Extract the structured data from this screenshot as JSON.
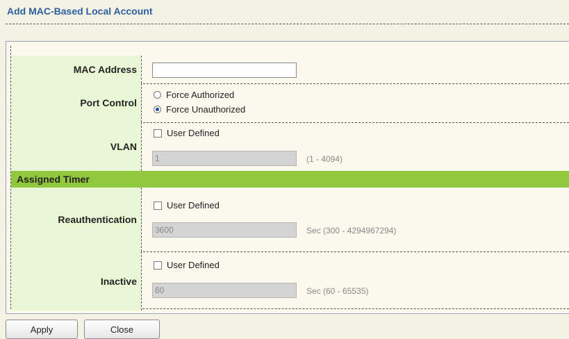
{
  "page": {
    "title": "Add MAC-Based Local Account"
  },
  "form": {
    "mac_address": {
      "label": "MAC Address",
      "value": ""
    },
    "port_control": {
      "label": "Port Control",
      "options": [
        {
          "label": "Force Authorized",
          "selected": false
        },
        {
          "label": "Force Unauthorized",
          "selected": true
        }
      ]
    },
    "vlan": {
      "label": "VLAN",
      "user_defined_label": "User Defined",
      "user_defined_checked": false,
      "value": "1",
      "range": "(1 - 4094)"
    },
    "assigned_timer": {
      "header": "Assigned Timer"
    },
    "reauthentication": {
      "label": "Reauthentication",
      "user_defined_label": "User Defined",
      "user_defined_checked": false,
      "value": "3600",
      "range": "Sec (300 - 4294967294)"
    },
    "inactive": {
      "label": "Inactive",
      "user_defined_label": "User Defined",
      "user_defined_checked": false,
      "value": "60",
      "range": "Sec (60 - 65535)"
    }
  },
  "buttons": {
    "apply": "Apply",
    "close": "Close"
  },
  "colors": {
    "title": "#2d5f9e",
    "label_bg": "#eaf7d6",
    "section_header_bg": "#91c83e",
    "page_bg": "#f4f2e4"
  }
}
